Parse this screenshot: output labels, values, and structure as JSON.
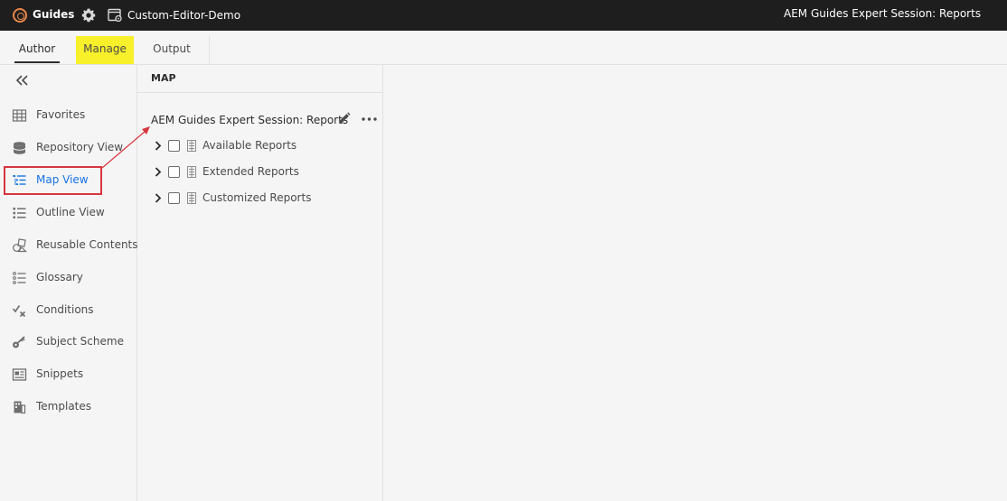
{
  "topbar": {
    "brand": "Guides",
    "doc_name": "Custom-Editor-Demo",
    "session_title": "AEM Guides Expert Session: Reports"
  },
  "tabs": [
    {
      "label": "Author"
    },
    {
      "label": "Manage"
    },
    {
      "label": "Output"
    }
  ],
  "sidebar": {
    "items": [
      {
        "label": "Favorites",
        "icon": "grid-icon"
      },
      {
        "label": "Repository View",
        "icon": "database-icon"
      },
      {
        "label": "Map View",
        "icon": "map-list-icon",
        "active": true
      },
      {
        "label": "Outline View",
        "icon": "outline-icon"
      },
      {
        "label": "Reusable Contents",
        "icon": "shapes-icon"
      },
      {
        "label": "Glossary",
        "icon": "glossary-icon"
      },
      {
        "label": "Conditions",
        "icon": "conditions-icon"
      },
      {
        "label": "Subject Scheme",
        "icon": "key-icon"
      },
      {
        "label": "Snippets",
        "icon": "snippet-icon"
      },
      {
        "label": "Templates",
        "icon": "templates-icon"
      }
    ]
  },
  "map": {
    "header": "MAP",
    "root_title": "AEM Guides Expert Session: Reports",
    "topics": [
      {
        "label": "Available Reports"
      },
      {
        "label": "Extended Reports"
      },
      {
        "label": "Customized Reports"
      }
    ]
  },
  "colors": {
    "topbar_bg": "#1e1e1e",
    "manage_highlight": "#f7f02a",
    "annotation_red": "#d7373f",
    "active_blue": "#1473e6"
  }
}
